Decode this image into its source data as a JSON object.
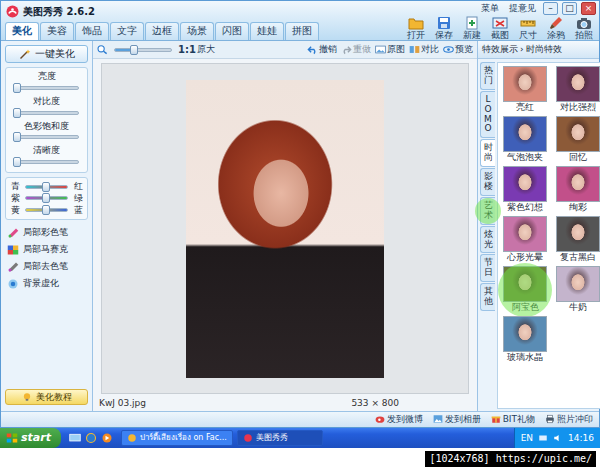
{
  "window": {
    "title": "美图秀秀 2.6.2",
    "menu": [
      "菜单",
      "提意见"
    ],
    "controls": [
      "–",
      "□",
      "×"
    ]
  },
  "tabs": [
    {
      "label": "美化",
      "selected": true
    },
    {
      "label": "美容",
      "selected": false
    },
    {
      "label": "饰品",
      "selected": false
    },
    {
      "label": "文字",
      "selected": false
    },
    {
      "label": "边框",
      "selected": false
    },
    {
      "label": "场景",
      "selected": false
    },
    {
      "label": "闪图",
      "selected": false
    },
    {
      "label": "娃娃",
      "selected": false
    },
    {
      "label": "拼图",
      "selected": false
    }
  ],
  "toolbar": [
    {
      "label": "打开"
    },
    {
      "label": "保存"
    },
    {
      "label": "新建"
    },
    {
      "label": "截图"
    },
    {
      "label": "尺寸"
    },
    {
      "label": "涂鸦"
    },
    {
      "label": "拍照"
    }
  ],
  "view": {
    "zoom_level": 0.35,
    "zoom_reset": "1:1",
    "zoom_label": "原大",
    "actions": [
      {
        "label": "撤销",
        "disabled": false
      },
      {
        "label": "重做",
        "disabled": true
      },
      {
        "label": "原图",
        "disabled": false
      },
      {
        "label": "对比",
        "disabled": false
      },
      {
        "label": "预览",
        "disabled": false
      }
    ]
  },
  "left_panel": {
    "one_click": "一键美化",
    "sliders": [
      {
        "label": "亮度",
        "level": 0.05
      },
      {
        "label": "对比度",
        "level": 0.05
      },
      {
        "label": "色彩饱和度",
        "level": 0.05
      },
      {
        "label": "清晰度",
        "level": 0.05
      }
    ],
    "color_sliders": [
      {
        "left": "青",
        "right": "红",
        "level": 0.5,
        "color": "#2fc3d3",
        "color_end": "#e0433f"
      },
      {
        "left": "紫",
        "right": "绿",
        "level": 0.5,
        "color": "#b04fd0",
        "color_end": "#3fbf4f"
      },
      {
        "left": "黄",
        "right": "蓝",
        "level": 0.5,
        "color": "#e8d23a",
        "color_end": "#3a66d8"
      }
    ],
    "tools": [
      "局部彩色笔",
      "局部马赛克",
      "局部去色笔",
      "背景虚化"
    ],
    "tutorial": "美化教程"
  },
  "canvas": {
    "filename": "KwJ 03.jpg",
    "size": "533 × 800"
  },
  "effects": {
    "header": "特效展示",
    "separator": "›",
    "breadcrumb": "时尚特效",
    "categories": [
      {
        "label": "热门",
        "selected": false,
        "highlighted": false
      },
      {
        "label": "LOMO",
        "selected": false,
        "highlighted": false
      },
      {
        "label": "时尚",
        "selected": true,
        "highlighted": false
      },
      {
        "label": "影楼",
        "selected": false,
        "highlighted": false
      },
      {
        "label": "艺术",
        "selected": false,
        "highlighted": true
      },
      {
        "label": "炫光",
        "selected": false,
        "highlighted": false
      },
      {
        "label": "节日",
        "selected": false,
        "highlighted": false
      },
      {
        "label": "其他",
        "selected": false,
        "highlighted": false
      }
    ],
    "items": [
      {
        "label": "亮红",
        "highlighted": false,
        "color": "#d8897a"
      },
      {
        "label": "对比强烈",
        "highlighted": false,
        "color": "#6d3a5e"
      },
      {
        "label": "气泡泡夹",
        "highlighted": false,
        "color": "#3f5fb8"
      },
      {
        "label": "回忆",
        "highlighted": false,
        "color": "#8c5a38"
      },
      {
        "label": "紫色幻想",
        "highlighted": false,
        "color": "#7a3ab2"
      },
      {
        "label": "绚彩",
        "highlighted": false,
        "color": "#c2508a"
      },
      {
        "label": "心形光晕",
        "highlighted": false,
        "color": "#c774a8"
      },
      {
        "label": "复古黑白",
        "highlighted": false,
        "color": "#555555"
      },
      {
        "label": "阿宝色",
        "highlighted": true,
        "color": "#6b7a3a"
      },
      {
        "label": "牛奶",
        "highlighted": false,
        "color": "#c4b4cc"
      },
      {
        "label": "玻璃水晶",
        "highlighted": false,
        "color": "#5a8cb4"
      }
    ]
  },
  "status_bar": [
    "发到微博",
    "发到相册",
    "BIT礼物",
    "照片冲印"
  ],
  "taskbar": {
    "start": "start",
    "items": [
      {
        "label": "ปาร์ตี้เสียงเรื่อง on Fac...",
        "selected": false
      },
      {
        "label": "美图秀秀",
        "selected": true
      }
    ],
    "lang": "EN",
    "time": "14:16"
  },
  "caption": "[1024x768] https://upic.me/"
}
